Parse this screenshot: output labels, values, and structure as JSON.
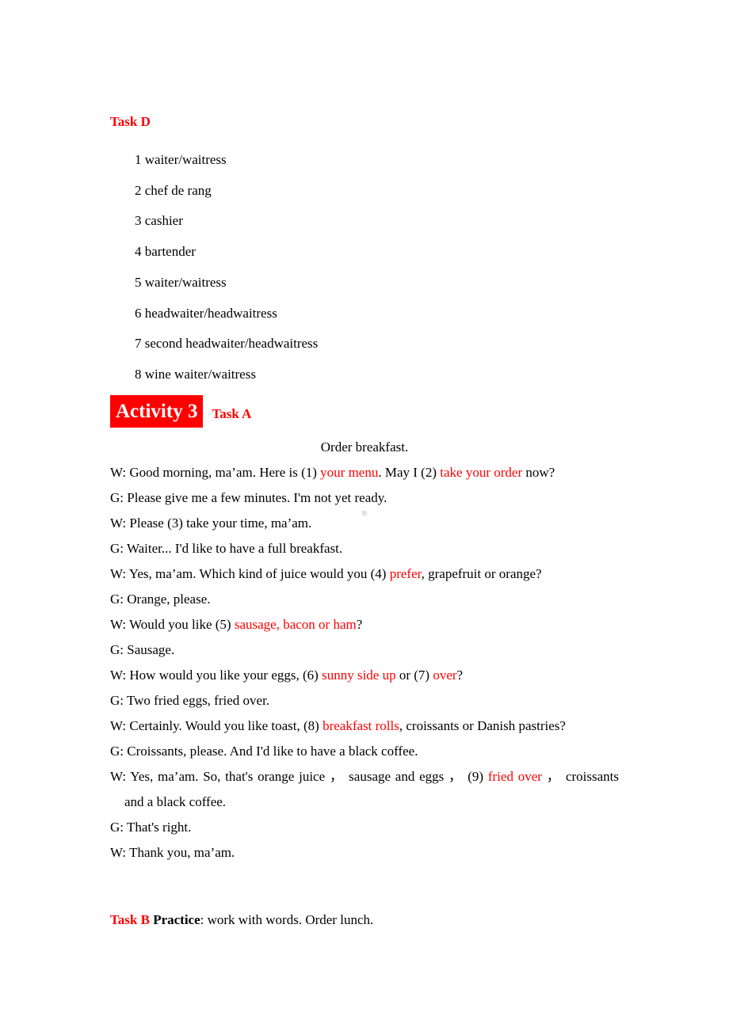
{
  "document": {
    "task_d": {
      "heading": "Task D",
      "items": [
        "1 waiter/waitress",
        "2 chef de rang",
        "3 cashier",
        "4 bartender",
        "5 waiter/waitress",
        "6 headwaiter/headwaitress",
        "7 second headwaiter/headwaitress",
        "8 wine waiter/waitress"
      ]
    },
    "activity": {
      "badge_label": "Activity 3",
      "task_label": "Task A",
      "accent_color": "#ff0000",
      "badge_text_color": "#ffffff"
    },
    "dialogue": {
      "title": "Order breakfast.",
      "lines": [
        {
          "speaker": "W: ",
          "seg1": "Good morning, ma’am. Here is (1) ",
          "answer1": "your menu",
          "seg2": ". May I (2) ",
          "answer2": "take your order",
          "seg3": " now?"
        },
        {
          "speaker": "G: ",
          "seg1": "Please give me a few minutes. I'm not yet ready."
        },
        {
          "speaker": "W: ",
          "seg1": "Please (3) take your time, ma’am."
        },
        {
          "speaker": "G: ",
          "seg1": "Waiter... I'd like to have a full breakfast."
        },
        {
          "speaker": "W: ",
          "seg1": "Yes, ma’am. Which kind of juice would you (4) ",
          "answer1": "prefer",
          "seg2": ", grapefruit or orange?"
        },
        {
          "speaker": "G: ",
          "seg1": "Orange, please."
        },
        {
          "speaker": "W: ",
          "seg1": "Would you like (5) ",
          "answer1": "sausage, bacon or ham",
          "seg2": "?"
        },
        {
          "speaker": "G: ",
          "seg1": "Sausage."
        },
        {
          "speaker": "W: ",
          "seg1": "How would you like your eggs, (6) ",
          "answer1": "sunny side up",
          "seg2": " or (7) ",
          "answer2": "over",
          "seg3": "?"
        },
        {
          "speaker": "G: ",
          "seg1": "Two fried eggs, fried over."
        },
        {
          "speaker": "W: ",
          "seg1": "Certainly. Would you like toast, (8) ",
          "answer1": "breakfast rolls",
          "seg2": ", croissants or Danish pastries?"
        },
        {
          "speaker": "G: ",
          "seg1": "Croissants, please. And I'd like to have a black coffee."
        },
        {
          "speaker": "W: ",
          "seg1": "Yes, ma’am. So, that's orange juice ， sausage and eggs ， (9) ",
          "answer1": "fried over",
          "seg2": " ， croissants and a black coffee."
        },
        {
          "speaker": "G: ",
          "seg1": "That's right."
        },
        {
          "speaker": "W: ",
          "seg1": "Thank you, ma’am."
        }
      ]
    },
    "practice": {
      "task_label": "Task B",
      "bold_word": "Practice",
      "rest": ": work with words. Order lunch."
    }
  }
}
